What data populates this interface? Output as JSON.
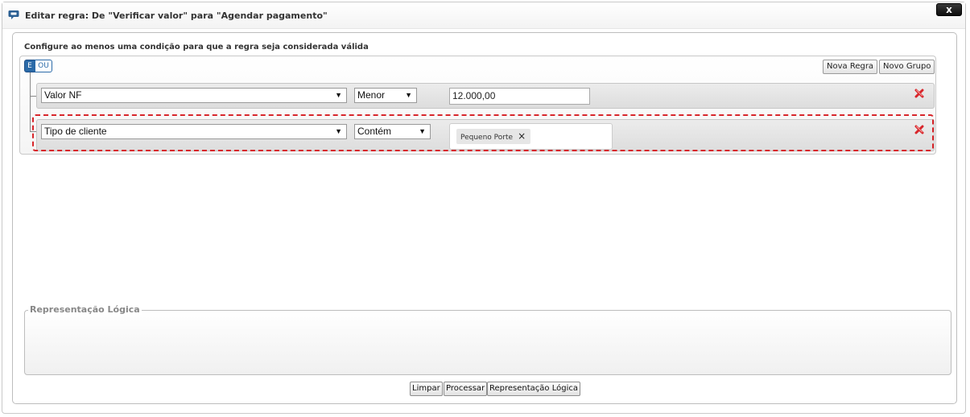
{
  "dialog": {
    "title": "Editar regra: De \"Verificar valor\" para \"Agendar pagamento\"",
    "close_label": "x"
  },
  "instructions": "Configure ao menos uma condição para que a regra seja considerada válida",
  "group": {
    "and_label": "E",
    "or_label": "OU",
    "active_operator": "E",
    "new_rule_label": "Nova Regra",
    "new_group_label": "Novo Grupo"
  },
  "rules": [
    {
      "field": "Valor NF",
      "operator": "Menor",
      "value": "12.000,00"
    },
    {
      "field": "Tipo de cliente",
      "operator": "Contém",
      "tags": [
        "Pequeno Porte"
      ]
    }
  ],
  "logic": {
    "legend": "Representação Lógica",
    "content": ""
  },
  "buttons": {
    "clear": "Limpar",
    "process": "Processar",
    "logic": "Representação Lógica"
  },
  "colors": {
    "accent": "#2b6aa8",
    "delete": "#d8262b",
    "highlight_border": "#d8262b"
  },
  "icons": {
    "app": "comment-icon",
    "delete": "delete-x-icon",
    "dropdown": "triangle-down"
  }
}
